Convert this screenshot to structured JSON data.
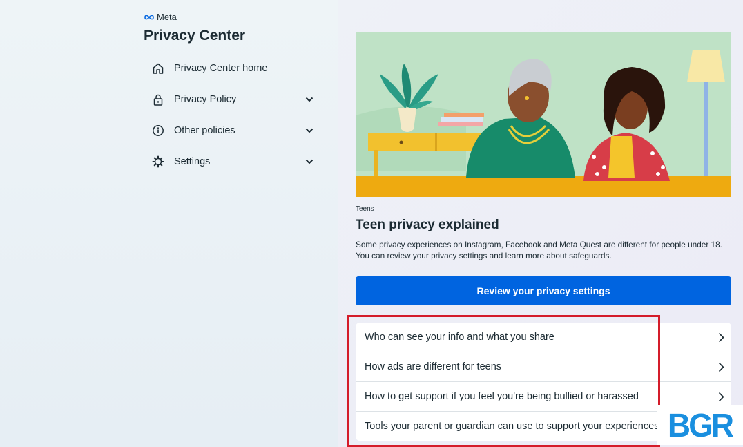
{
  "brand": {
    "name": "Meta"
  },
  "page": {
    "title": "Privacy Center"
  },
  "nav": {
    "items": [
      {
        "label": "Privacy Center home",
        "icon": "home-icon"
      },
      {
        "label": "Privacy Policy",
        "icon": "lock-icon",
        "expandable": true
      },
      {
        "label": "Other policies",
        "icon": "info-icon",
        "expandable": true
      },
      {
        "label": "Settings",
        "icon": "gear-icon",
        "expandable": true
      }
    ]
  },
  "main": {
    "eyebrow": "Teens",
    "title": "Teen privacy explained",
    "description": "Some privacy experiences on Instagram, Facebook and Meta Quest are different for people under 18. You can review your privacy settings and learn more about safeguards.",
    "cta_label": "Review your privacy settings",
    "links": [
      {
        "label": "Who can see your info and what you share"
      },
      {
        "label": "How ads are different for teens"
      },
      {
        "label": "How to get support if you feel you're being bullied or harassed"
      },
      {
        "label": "Tools your parent or guardian can use to support your experiences"
      }
    ]
  },
  "watermark": {
    "text": "BGR"
  },
  "colors": {
    "accent": "#0064e0",
    "highlight": "#d41c2a",
    "text": "#1c2b33",
    "watermark": "#1a8fdf"
  }
}
